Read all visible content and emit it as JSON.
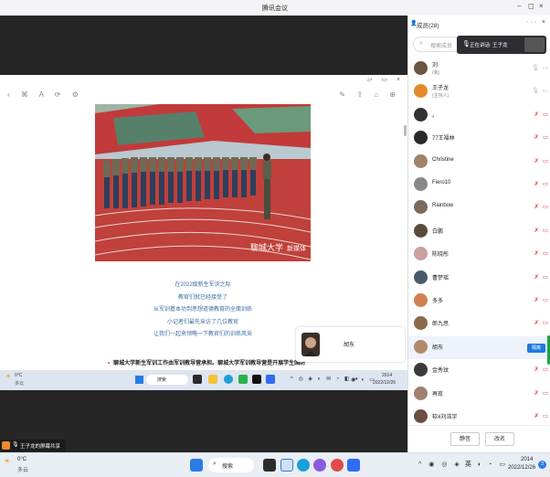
{
  "window": {
    "title": "腾讯会议",
    "min": "–",
    "max": "◻",
    "close": "×"
  },
  "shared_doc": {
    "toolbar_left": "‹ ⌘ A  ⟳ ⚙",
    "toolbar_right": "✎ ⇪ ⌂ ⊕",
    "top_controls": "▱ ▭ ×",
    "photo_watermark": "聊城大学",
    "photo_watermark2": "新媒体",
    "lines": [
      "在2022级新生军训之际",
      "教官们就已经接受了",
      "从军训基本功到思想道德教育的全面训练",
      "小记者们最先采访了几位教官",
      "让我们一起来领略一下教官们的训练风采"
    ],
    "bold_line": "聊城大学新生军训工作由军训教导营承担。聊城大学军训教导营是开展学生国防"
  },
  "remote_taskbar": {
    "weather_temp": "0°C",
    "weather_text": "多云",
    "search": "搜索",
    "time": "2014",
    "date": "2022/12/26"
  },
  "speaker_tile": {
    "name": "胡东"
  },
  "panel": {
    "title": "成员(28)",
    "head_btns": "··· ×",
    "search_placeholder": "搜索成员",
    "toast": "正在讲话: 王子龙",
    "members": [
      {
        "name": "刘",
        "sub": "(我)",
        "muted": false
      },
      {
        "name": "王子龙",
        "sub": "(主持人)",
        "muted": false
      },
      {
        "name": "。",
        "sub": "",
        "muted": true
      },
      {
        "name": "77王福林",
        "sub": "",
        "muted": true
      },
      {
        "name": "Christine",
        "sub": "",
        "muted": true
      },
      {
        "name": "Fiero10",
        "sub": "",
        "muted": true
      },
      {
        "name": "Rainbow",
        "sub": "",
        "muted": true
      },
      {
        "name": "白鹏",
        "sub": "",
        "muted": true
      },
      {
        "name": "陈晓彤",
        "sub": "",
        "muted": true
      },
      {
        "name": "曹梦瑶",
        "sub": "",
        "muted": true
      },
      {
        "name": "多多",
        "sub": "",
        "muted": true
      },
      {
        "name": "郎九思",
        "sub": "",
        "muted": true
      },
      {
        "name": "胡东",
        "sub": "",
        "muted": true
      },
      {
        "name": "金秀玟",
        "sub": "",
        "muted": true
      },
      {
        "name": "再玫",
        "sub": "",
        "muted": true
      },
      {
        "name": "软4刘浩宇",
        "sub": "",
        "muted": true
      }
    ],
    "mute_label": "隔离",
    "footer": {
      "mute_all": "静音",
      "rename": "改名"
    }
  },
  "share_indicator": {
    "text": "王子龙的屏幕共享"
  },
  "taskbar": {
    "weather_temp": "0°C",
    "weather_text": "多云",
    "search": "搜索",
    "ime": "英",
    "time": "2014",
    "date": "2022/12/26",
    "notif": "3"
  },
  "colors": {
    "accent": "#1f7ae0",
    "muted": "#e23b3b",
    "text_blue": "#3d6aa5"
  }
}
